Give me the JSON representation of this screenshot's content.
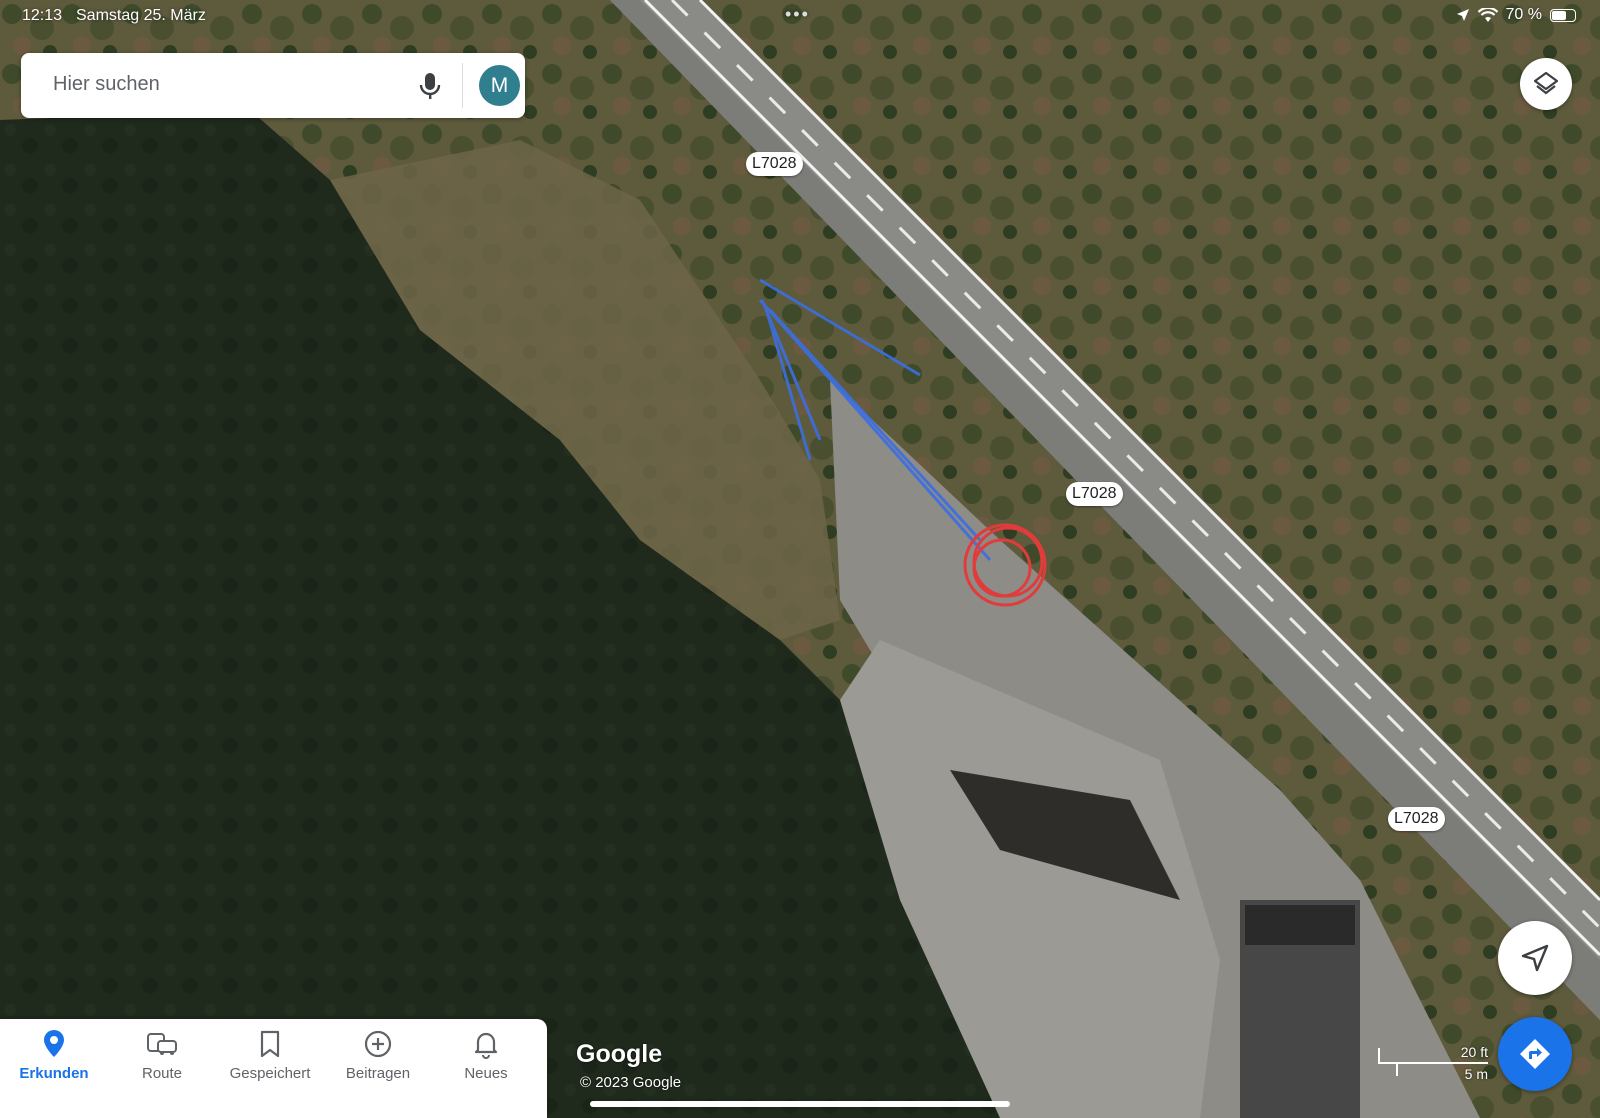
{
  "status_bar": {
    "time": "12:13",
    "date": "Samstag 25. März",
    "dots": "•••",
    "battery_text": "70 %",
    "battery_level": 0.7
  },
  "search": {
    "placeholder": "Hier suchen",
    "avatar_letter": "M"
  },
  "map": {
    "road_labels": [
      "L7028",
      "L7028",
      "L7028"
    ],
    "google_logo": "Google",
    "copyright": "© 2023 Google",
    "scale_ft": "20 ft",
    "scale_m": "5 m"
  },
  "nav": {
    "items": [
      {
        "label": "Erkunden",
        "icon": "pin-icon",
        "active": true
      },
      {
        "label": "Route",
        "icon": "car-bus-icon",
        "active": false
      },
      {
        "label": "Gespeichert",
        "icon": "bookmark-icon",
        "active": false
      },
      {
        "label": "Beitragen",
        "icon": "add-circle-icon",
        "active": false
      },
      {
        "label": "Neues",
        "icon": "bell-icon",
        "active": false
      }
    ]
  },
  "colors": {
    "accent": "#1a73e8",
    "avatar_bg": "#2f7f8f",
    "annotation_blue": "#3b6fe0",
    "annotation_red": "#e03c3c"
  }
}
